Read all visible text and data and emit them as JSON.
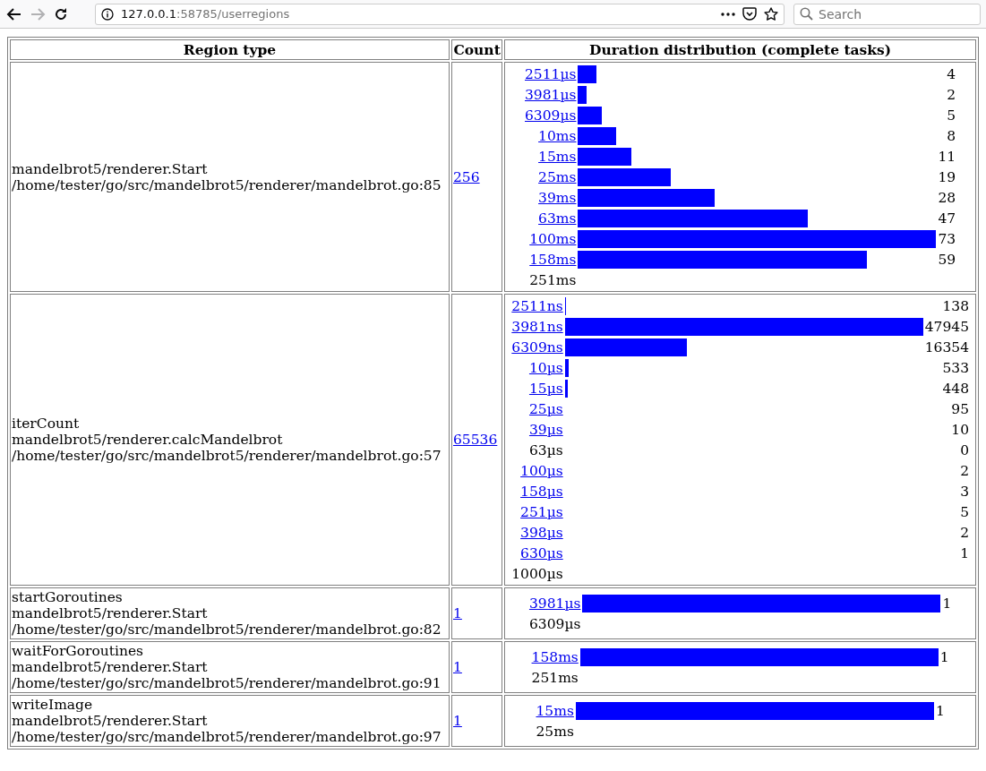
{
  "browser": {
    "url_host": "127.0.0.1",
    "url_path": ":58785/userregions",
    "search_placeholder": "Search",
    "forward_disabled": true
  },
  "table": {
    "columns": [
      "Region type",
      "Count",
      "Duration distribution (complete tasks)"
    ],
    "rows": [
      {
        "region_lines": [
          "mandelbrot5/renderer.Start",
          "/home/tester/go/src/mandelbrot5/renderer/mandelbrot.go:85"
        ],
        "count": "256",
        "buckets": [
          {
            "label": "2511µs",
            "linked": true,
            "level": 0.0548,
            "count": "4"
          },
          {
            "label": "3981µs",
            "linked": true,
            "level": 0.0274,
            "count": "2"
          },
          {
            "label": "6309µs",
            "linked": true,
            "level": 0.0685,
            "count": "5"
          },
          {
            "label": "10ms",
            "linked": true,
            "level": 0.1096,
            "count": "8"
          },
          {
            "label": "15ms",
            "linked": true,
            "level": 0.1507,
            "count": "11"
          },
          {
            "label": "25ms",
            "linked": true,
            "level": 0.2603,
            "count": "19"
          },
          {
            "label": "39ms",
            "linked": true,
            "level": 0.3836,
            "count": "28"
          },
          {
            "label": "63ms",
            "linked": true,
            "level": 0.6438,
            "count": "47"
          },
          {
            "label": "100ms",
            "linked": true,
            "level": 1,
            "count": "73"
          },
          {
            "label": "158ms",
            "linked": true,
            "level": 0.8082,
            "count": "59"
          }
        ],
        "upper_bound": "251ms"
      },
      {
        "region_lines": [
          "iterCount",
          "mandelbrot5/renderer.calcMandelbrot",
          "/home/tester/go/src/mandelbrot5/renderer/mandelbrot.go:57"
        ],
        "count": "65536",
        "buckets": [
          {
            "label": "2511ns",
            "linked": true,
            "level": 0.0029,
            "count": "138"
          },
          {
            "label": "3981ns",
            "linked": true,
            "level": 1,
            "count": "47945"
          },
          {
            "label": "6309ns",
            "linked": true,
            "level": 0.3411,
            "count": "16354"
          },
          {
            "label": "10µs",
            "linked": true,
            "level": 0.0111,
            "count": "533"
          },
          {
            "label": "15µs",
            "linked": true,
            "level": 0.0093,
            "count": "448"
          },
          {
            "label": "25µs",
            "linked": true,
            "count": "95"
          },
          {
            "label": "39µs",
            "linked": true,
            "count": "10"
          },
          {
            "label": "63µs",
            "linked": false,
            "count": "0"
          },
          {
            "label": "100µs",
            "linked": true,
            "count": "2"
          },
          {
            "label": "158µs",
            "linked": true,
            "count": "3"
          },
          {
            "label": "251µs",
            "linked": true,
            "count": "5"
          },
          {
            "label": "398µs",
            "linked": true,
            "count": "2"
          },
          {
            "label": "630µs",
            "linked": true,
            "count": "1"
          }
        ],
        "upper_bound": "1000µs"
      },
      {
        "region_lines": [
          "startGoroutines",
          "mandelbrot5/renderer.Start",
          "/home/tester/go/src/mandelbrot5/renderer/mandelbrot.go:82"
        ],
        "count": "1",
        "buckets": [
          {
            "label": "3981µs",
            "linked": true,
            "level": 1,
            "count": "1"
          }
        ],
        "upper_bound": "6309µs"
      },
      {
        "region_lines": [
          "waitForGoroutines",
          "mandelbrot5/renderer.Start",
          "/home/tester/go/src/mandelbrot5/renderer/mandelbrot.go:91"
        ],
        "count": "1",
        "buckets": [
          {
            "label": "158ms",
            "linked": true,
            "level": 1,
            "count": "1"
          }
        ],
        "upper_bound": "251ms"
      },
      {
        "region_lines": [
          "writeImage",
          "mandelbrot5/renderer.Start",
          "/home/tester/go/src/mandelbrot5/renderer/mandelbrot.go:97"
        ],
        "count": "1",
        "buckets": [
          {
            "label": "15ms",
            "linked": true,
            "level": 1,
            "count": "1"
          }
        ],
        "upper_bound": "25ms"
      }
    ]
  }
}
